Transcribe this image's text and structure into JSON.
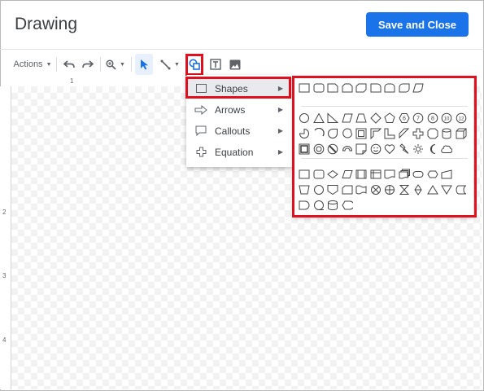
{
  "dialog": {
    "title": "Drawing",
    "save_label": "Save and Close"
  },
  "toolbar": {
    "actions_label": "Actions"
  },
  "ruler": {
    "h_marks": [
      "1"
    ],
    "v_marks": [
      "2",
      "3",
      "4"
    ]
  },
  "shape_menu": {
    "items": [
      {
        "label": "Shapes",
        "icon": "rectangle-icon",
        "selected": true
      },
      {
        "label": "Arrows",
        "icon": "arrow-icon",
        "selected": false
      },
      {
        "label": "Callouts",
        "icon": "callout-icon",
        "selected": false
      },
      {
        "label": "Equation",
        "icon": "plus-icon",
        "selected": false
      }
    ]
  },
  "shapes_palette": {
    "row1": [
      "rect",
      "rect-rounded",
      "snip1",
      "snip2",
      "snip-diag",
      "round1",
      "round2",
      "round-diag",
      "parallelogram-r"
    ],
    "row2": [
      "ellipse",
      "triangle",
      "right-triangle",
      "parallelogram",
      "trapezoid",
      "diamond",
      "pentagon",
      "hexagon",
      "heptagon",
      "octagon",
      "decagon",
      "dodecagon"
    ],
    "row3": [
      "pie",
      "arc",
      "tear",
      "chord",
      "frame",
      "half-frame",
      "l-shape",
      "diag-stripe",
      "plus",
      "octagon-cross",
      "can",
      "cube"
    ],
    "row4": [
      "bevel",
      "donut",
      "no-symbol",
      "block-arc",
      "folded-corner",
      "smiley",
      "heart",
      "lightning",
      "sun",
      "moon",
      "cloud"
    ],
    "row5": [
      "process",
      "alt-process",
      "decision",
      "data",
      "predefined",
      "internal-storage",
      "document",
      "multidoc",
      "terminator",
      "preparation",
      "manual-input"
    ],
    "row6": [
      "manual-op",
      "connector",
      "offpage",
      "card",
      "punched-tape",
      "summing",
      "or",
      "collate",
      "sort",
      "extract",
      "merge",
      "stored-data"
    ],
    "row7": [
      "delay",
      "seq-storage",
      "magnetic-disk",
      "display"
    ]
  }
}
